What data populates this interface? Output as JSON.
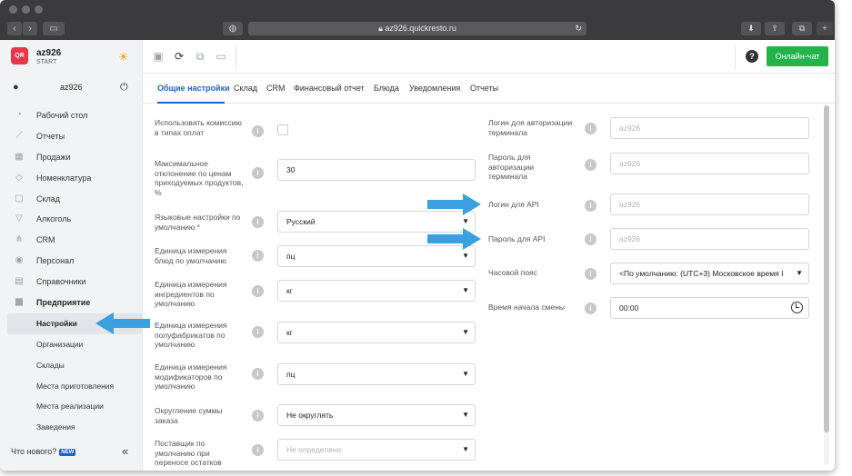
{
  "browser": {
    "url": "az926.quickresto.ru",
    "back_glyph": "‹",
    "forward_glyph": "›",
    "sidebar_glyph": "▭",
    "privacy_glyph": "◍",
    "reload_glyph": "↻",
    "download_glyph": "⬇",
    "share_glyph": "⇧",
    "tabs_glyph": "⧉",
    "newtab_glyph": "+"
  },
  "sidebar": {
    "logo": "QR",
    "org_name": "az926",
    "org_plan": "START",
    "user_name": "az926",
    "menu": [
      {
        "label": "Рабочий стол",
        "icon": "dashboard-icon",
        "glyph": "◔"
      },
      {
        "label": "Отчеты",
        "icon": "reports-icon",
        "glyph": "⟋"
      },
      {
        "label": "Продажи",
        "icon": "sales-icon",
        "glyph": "▦"
      },
      {
        "label": "Номенклатура",
        "icon": "tag-icon",
        "glyph": "◇"
      },
      {
        "label": "Склад",
        "icon": "warehouse-icon",
        "glyph": "▢"
      },
      {
        "label": "Алкоголь",
        "icon": "alcohol-icon",
        "glyph": "▽"
      },
      {
        "label": "CRM",
        "icon": "crm-icon",
        "glyph": "⋔"
      },
      {
        "label": "Персонал",
        "icon": "staff-icon",
        "glyph": "◉"
      },
      {
        "label": "Справочники",
        "icon": "catalog-icon",
        "glyph": "▤"
      },
      {
        "label": "Предприятие",
        "icon": "enterprise-icon",
        "glyph": "▩"
      }
    ],
    "submenu": [
      "Настройки",
      "Организации",
      "Склады",
      "Места приготовления",
      "Места реализации",
      "Заведения"
    ],
    "whats_new": "Что нового?",
    "new_badge": "NEW",
    "collapse_glyph": "«"
  },
  "toolbar": {
    "online_chat": "Онлайн-чат",
    "help": "?"
  },
  "tabs": [
    "Общие настройки",
    "Склад",
    "CRM",
    "Финансовый отчет",
    "Блюда",
    "Уведомления",
    "Отчеты"
  ],
  "left_form": [
    {
      "label": "Использовать комиссию в типах оплат",
      "type": "checkbox"
    },
    {
      "label": "Максимальное отклонение по ценам приходуемых продуктов, %",
      "type": "input",
      "value": "30"
    },
    {
      "label": "Языковые настройки по умолчанию",
      "required": "*",
      "type": "select",
      "value": "Русский"
    },
    {
      "label": "Единица измерения блюд по умолчанию",
      "type": "select",
      "value": "пц"
    },
    {
      "label": "Единица измерения ингредиентов по умолчанию",
      "type": "select",
      "value": "кг"
    },
    {
      "label": "Единица измерения полуфабрикатов по умолчанию",
      "type": "select",
      "value": "кг"
    },
    {
      "label": "Единица измерения модификаторов по умолчанию",
      "type": "select",
      "value": "пц"
    },
    {
      "label": "Округление суммы заказа",
      "type": "select",
      "value": "Не округлять"
    },
    {
      "label": "Поставщик по умолчанию при переносе остатков",
      "type": "select",
      "placeholder": "Не определено"
    }
  ],
  "right_form": [
    {
      "label": "Логин для авторизации терминала",
      "placeholder": "az926"
    },
    {
      "label": "Пароль для авторизации терминала",
      "placeholder": "az926"
    },
    {
      "label": "Логин для API",
      "placeholder": "az926"
    },
    {
      "label": "Пароль для API",
      "placeholder": "az926"
    },
    {
      "label": "Часовой пояс",
      "value": "<По умолчанию: (UTC+3) Московское время I"
    },
    {
      "label": "Время начала смены",
      "value": "00:00"
    }
  ],
  "colors": {
    "accent": "#1e62c9",
    "chat_button": "#24b34b",
    "logo": "#e5364a",
    "annotation_arrow": "#3aa0e0"
  }
}
